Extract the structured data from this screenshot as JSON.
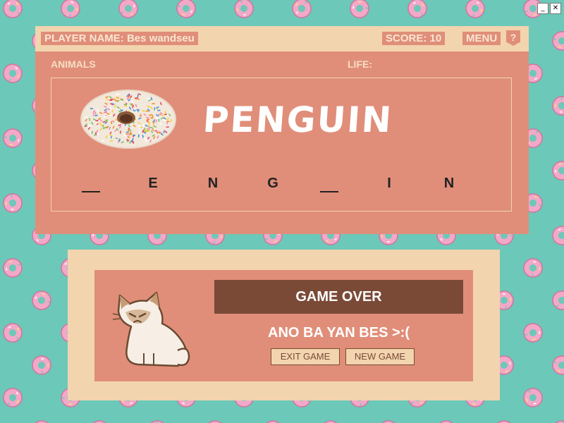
{
  "window_controls": {
    "minimize": "_",
    "close": "✕"
  },
  "header": {
    "player_label": "PLAYER NAME:",
    "player_name": "Bes wandseu",
    "score_label": "SCORE:",
    "score_value": "10",
    "menu_label": "MENU",
    "help_label": "?"
  },
  "board": {
    "category": "ANIMALS",
    "life_label": "LIFE:",
    "answer_word": "PENGUIN",
    "letters": [
      "",
      "E",
      "N",
      "G",
      "",
      "I",
      "N"
    ]
  },
  "result": {
    "title": "GAME OVER",
    "message": "ANO BA YAN BES >:(",
    "exit_label": "EXIT GAME",
    "new_label": "NEW GAME"
  },
  "colors": {
    "background": "#6cc8b8",
    "panel_salmon": "#e08e79",
    "panel_cream": "#f2d4af",
    "game_over_brown": "#7a4a37"
  },
  "icons": [
    "donut-icon",
    "sprinkle-donut-icon",
    "grumpy-cat-icon",
    "help-icon",
    "minimize-icon",
    "close-icon"
  ]
}
